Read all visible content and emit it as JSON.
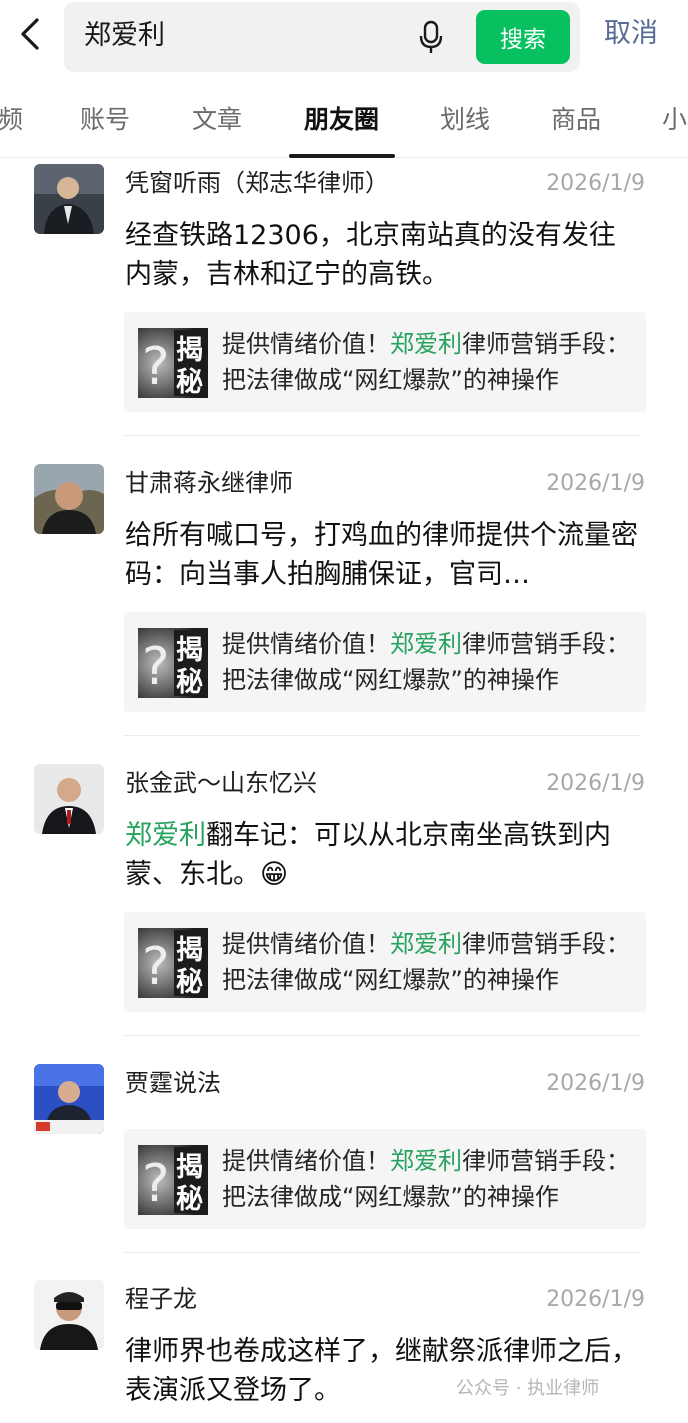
{
  "header": {
    "query": "郑爱利",
    "search_label": "搜索",
    "cancel_label": "取消"
  },
  "tabs": [
    {
      "label": "频"
    },
    {
      "label": "账号"
    },
    {
      "label": "文章"
    },
    {
      "label": "朋友圈",
      "active": true
    },
    {
      "label": "划线"
    },
    {
      "label": "商品"
    },
    {
      "label": "小"
    }
  ],
  "card": {
    "thumb_q": "?",
    "thumb_l1": "揭",
    "thumb_l2": "秘",
    "title_pre": "提供情绪价值！",
    "title_hl": "郑爱利",
    "title_post": "律师营销手段：把法律做成“网红爆款”的神操作"
  },
  "posts": [
    {
      "author": "凭窗听雨（郑志华律师）",
      "date": "2026/1/9",
      "content_pre": "经查铁路12306，北京南站真的没有发往内蒙，吉林和辽宁的高铁。",
      "content_hl": "",
      "content_post": ""
    },
    {
      "author": "甘肃蒋永继律师",
      "date": "2026/1/9",
      "content_pre": "给所有喊口号，打鸡血的律师提供个流量密码：向当事人拍胸脯保证，官司…",
      "content_hl": "",
      "content_post": ""
    },
    {
      "author": "张金武～山东忆兴",
      "date": "2026/1/9",
      "content_pre": "",
      "content_hl": "郑爱利",
      "content_post": "翻车记：可以从北京南坐高铁到内蒙、东北。😁"
    },
    {
      "author": "贾霆说法",
      "date": "2026/1/9",
      "content_pre": "",
      "content_hl": "",
      "content_post": ""
    },
    {
      "author": "程子龙",
      "date": "2026/1/9",
      "content_pre": "律师界也卷成这样了，继献祭派律师之后，表演派又登场了。",
      "content_hl": "",
      "content_post": ""
    }
  ],
  "watermark": "公众号 · 执业律师",
  "colors": {
    "accent": "#07c160",
    "highlight": "#27a35f",
    "link": "#576b95"
  }
}
